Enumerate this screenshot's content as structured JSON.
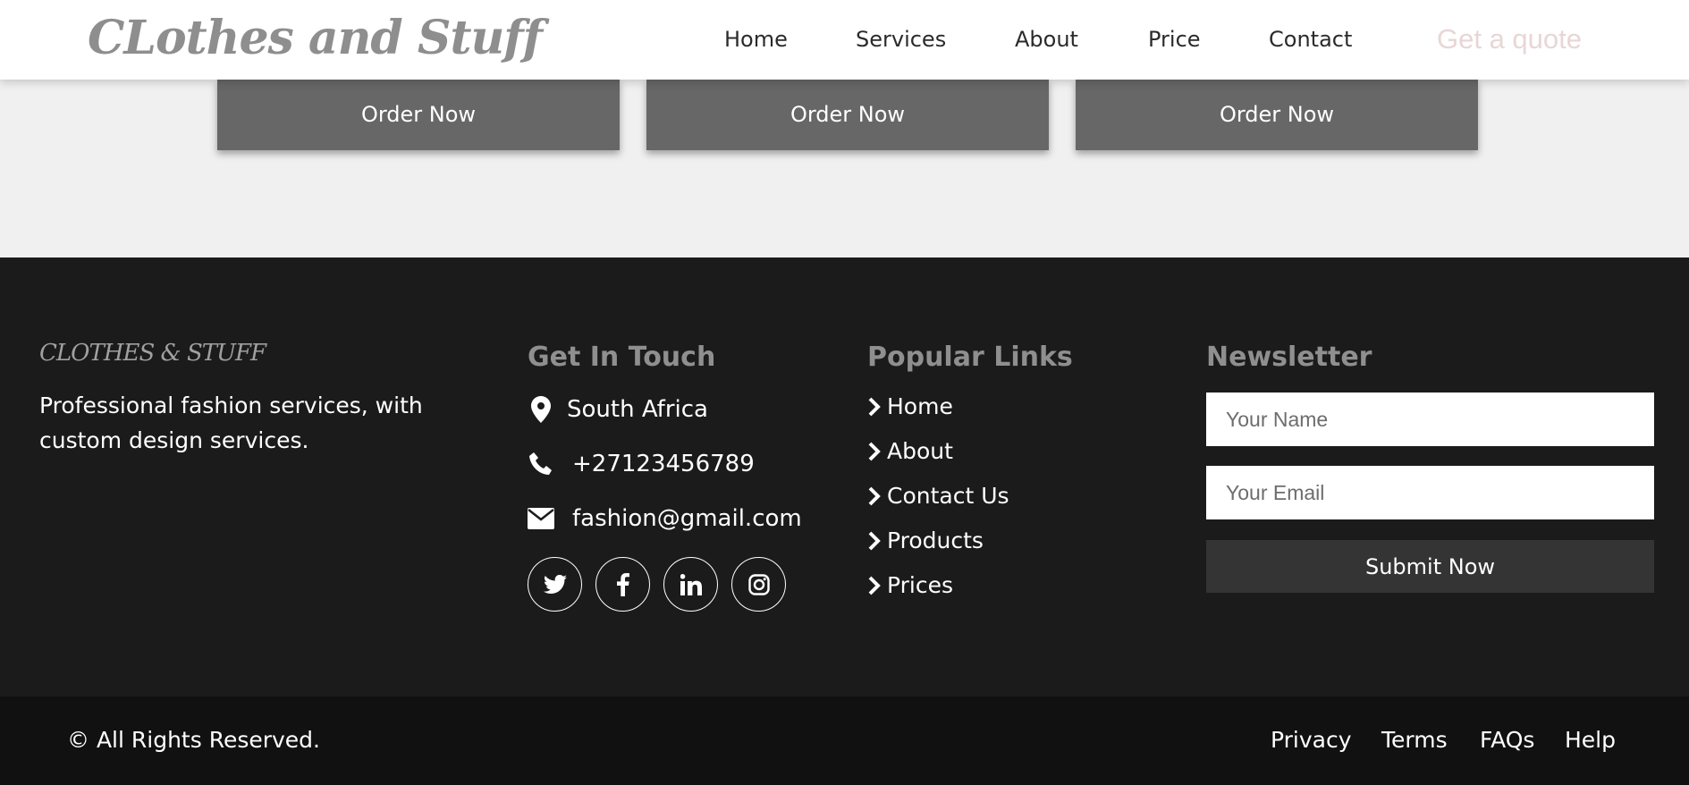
{
  "header": {
    "logo": "CLothes and Stuff",
    "nav": [
      "Home",
      "Services",
      "About",
      "Price",
      "Contact"
    ],
    "cta": "Get a quote"
  },
  "pricing": {
    "buttons": [
      "Order Now",
      "Order Now",
      "Order Now"
    ]
  },
  "footer": {
    "brand": "CLOTHES & STUFF",
    "description": "Professional fashion services, with custom design services.",
    "contact": {
      "title": "Get In Touch",
      "location": "South Africa",
      "phone": "+27123456789",
      "email": "fashion@gmail.com",
      "socials": [
        "twitter-icon",
        "facebook-icon",
        "linkedin-icon",
        "instagram-icon"
      ]
    },
    "links": {
      "title": "Popular Links",
      "items": [
        "Home",
        "About",
        "Contact Us",
        "Products",
        "Prices"
      ]
    },
    "newsletter": {
      "title": "Newsletter",
      "name_placeholder": "Your Name",
      "email_placeholder": "Your Email",
      "submit": "Submit Now"
    }
  },
  "bottom": {
    "copyright": "© All Rights Reserved.",
    "links": [
      "Privacy",
      "Terms",
      "FAQs",
      "Help"
    ]
  },
  "colors": {
    "footer_bg": "#1b1b1b",
    "bottom_bg": "#111111",
    "button_gray": "#676767",
    "accent_quote": "#e8d6d6"
  }
}
